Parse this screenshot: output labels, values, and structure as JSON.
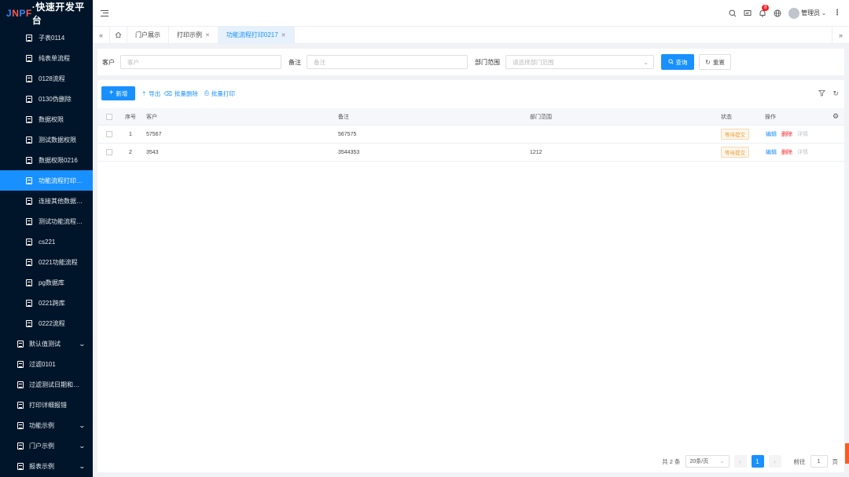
{
  "logo": {
    "part1": "J",
    "part2": "N",
    "part3": "P",
    "part4": "F",
    "rest": "·快速开发平台"
  },
  "sidebar": {
    "items": [
      {
        "label": "子表0114"
      },
      {
        "label": "纯表单流程"
      },
      {
        "label": "0128流程"
      },
      {
        "label": "0130伪删除"
      },
      {
        "label": "数据权限"
      },
      {
        "label": "测试数据权限"
      },
      {
        "label": "数据权限0216"
      },
      {
        "label": "功能流程打印…",
        "active": true
      },
      {
        "label": "连接其他数据…"
      },
      {
        "label": "测试功能流程…"
      },
      {
        "label": "cs221"
      },
      {
        "label": "0221功能流程"
      },
      {
        "label": "pg数据库"
      },
      {
        "label": "0221跨库"
      },
      {
        "label": "0222流程"
      }
    ],
    "groups": [
      {
        "label": "默认值测试",
        "icon": "cluster-icon",
        "chevron": true
      },
      {
        "label": "过滤0101",
        "icon": "checklist-icon",
        "chevron": false
      },
      {
        "label": "过滤测试日期和…",
        "icon": "message-icon",
        "chevron": false
      },
      {
        "label": "打印详细报错",
        "icon": "phone-icon",
        "chevron": false
      },
      {
        "label": "功能示例",
        "icon": "edit-icon",
        "chevron": true
      },
      {
        "label": "门户示例",
        "icon": "window-icon",
        "chevron": true
      },
      {
        "label": "报表示例",
        "icon": "report-icon",
        "chevron": true
      }
    ]
  },
  "header": {
    "notification_count": "8",
    "user_name": "管理员"
  },
  "tabs": [
    {
      "label": "门户展示",
      "closable": false
    },
    {
      "label": "打印示例",
      "closable": true
    },
    {
      "label": "功能流程打印0217",
      "closable": true,
      "active": true
    }
  ],
  "search": {
    "customer_label": "客户",
    "customer_placeholder": "客户",
    "remark_label": "备注",
    "remark_placeholder": "备注",
    "dept_label": "部门范围",
    "dept_placeholder": "请选择部门范围",
    "query_label": "查询",
    "reset_label": "重置"
  },
  "toolbar": {
    "add_label": "新增",
    "export_label": "导出",
    "batch_delete_label": "批量删除",
    "batch_print_label": "批量打印"
  },
  "table": {
    "columns": [
      "序号",
      "客户",
      "备注",
      "部门范围",
      "状态",
      "操作"
    ],
    "rows": [
      {
        "index": "1",
        "customer": "57567",
        "remark": "567575",
        "dept": "",
        "status": "等待提交",
        "actions": [
          "编辑",
          "删除",
          "详情"
        ]
      },
      {
        "index": "2",
        "customer": "3543",
        "remark": "3544353",
        "dept": "1212",
        "status": "等待提交",
        "actions": [
          "编辑",
          "删除",
          "详情"
        ]
      }
    ]
  },
  "pagination": {
    "total_text": "共 2 条",
    "page_size": "20条/页",
    "current_page": "1",
    "goto_label": "前往",
    "goto_value": "1",
    "page_unit": "页"
  },
  "colors": {
    "sidebar_bg": "#001529",
    "primary": "#1890ff",
    "danger": "#f5222d",
    "warning": "#e6a23c"
  }
}
